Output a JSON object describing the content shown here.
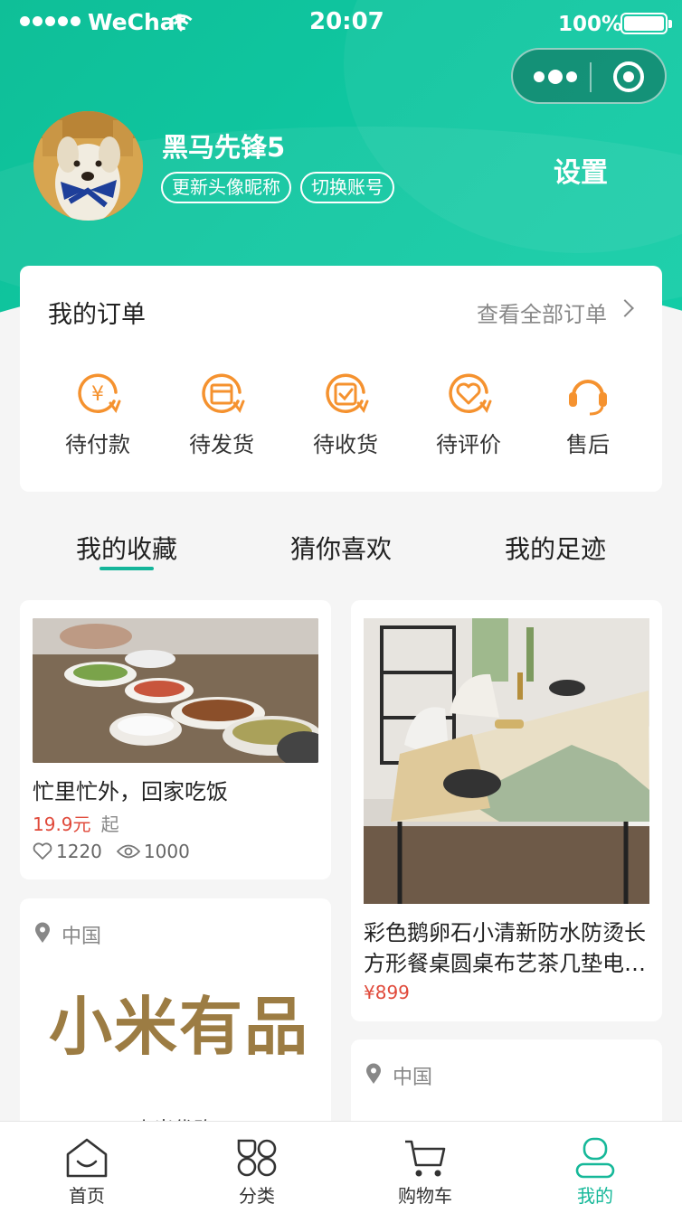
{
  "status_bar": {
    "carrier": "WeChat",
    "time": "20:07",
    "battery": "100%"
  },
  "profile": {
    "nickname": "黑马先锋5",
    "update_avatar_label": "更新头像昵称",
    "switch_account_label": "切换账号",
    "settings_label": "设置"
  },
  "orders": {
    "title": "我的订单",
    "view_all": "查看全部订单",
    "items": [
      {
        "label": "待付款",
        "icon": "payment-icon"
      },
      {
        "label": "待发货",
        "icon": "ship-icon"
      },
      {
        "label": "待收货",
        "icon": "receive-icon"
      },
      {
        "label": "待评价",
        "icon": "review-icon"
      },
      {
        "label": "售后",
        "icon": "headset-icon"
      }
    ]
  },
  "tabs": [
    {
      "label": "我的收藏",
      "active": true
    },
    {
      "label": "猜你喜欢",
      "active": false
    },
    {
      "label": "我的足迹",
      "active": false
    }
  ],
  "products": [
    {
      "title": "忙里忙外，回家吃饭",
      "price": "19.9元",
      "price_suffix": "起",
      "likes": "1220",
      "views": "1000"
    },
    {
      "title_line1": "彩色鹅卵石小清新防水防烫长",
      "title_line2": "方形餐桌圆桌布艺茶几垫电…",
      "price": "¥899"
    }
  ],
  "shops": [
    {
      "location": "中国",
      "brand": "小米有品",
      "name": "小米优购"
    },
    {
      "location": "中国"
    }
  ],
  "tabbar": [
    {
      "label": "首页",
      "icon": "home-icon"
    },
    {
      "label": "分类",
      "icon": "category-icon"
    },
    {
      "label": "购物车",
      "icon": "cart-icon"
    },
    {
      "label": "我的",
      "icon": "profile-icon",
      "active": true
    }
  ],
  "colors": {
    "accent": "#15b59a",
    "price": "#e0493a",
    "order_icon": "#f5922f"
  }
}
